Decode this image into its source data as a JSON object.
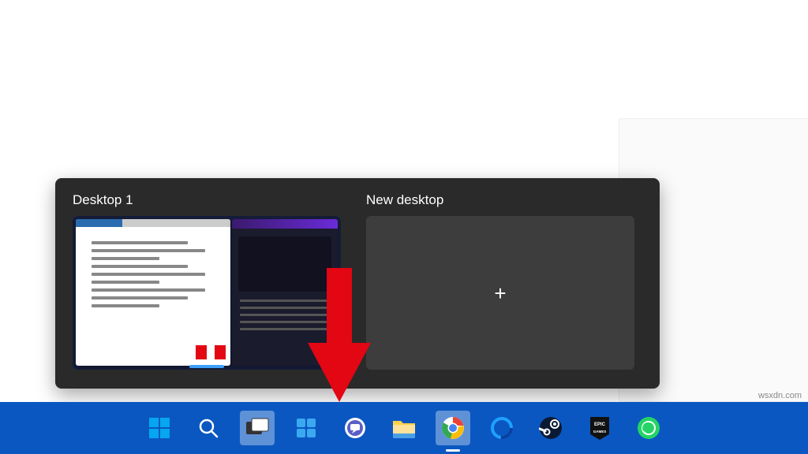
{
  "task_view": {
    "desktop_label": "Desktop 1",
    "new_desktop_label": "New desktop",
    "plus_symbol": "+"
  },
  "taskbar": {
    "items": [
      {
        "name": "start",
        "highlight": false
      },
      {
        "name": "search",
        "highlight": false
      },
      {
        "name": "task-view",
        "highlight": true
      },
      {
        "name": "widgets",
        "highlight": false
      },
      {
        "name": "chat",
        "highlight": false
      },
      {
        "name": "file-explorer",
        "highlight": false
      },
      {
        "name": "chrome",
        "highlight": true
      },
      {
        "name": "cortana",
        "highlight": false
      },
      {
        "name": "steam",
        "highlight": false
      },
      {
        "name": "epic-games",
        "highlight": false
      },
      {
        "name": "whatsapp",
        "highlight": false
      }
    ]
  },
  "watermark": "wsxdn.com",
  "colors": {
    "taskbar": "#0a57c2",
    "popup": "#2a2a2a",
    "arrow": "#e30613",
    "accent": "#3da0ff"
  }
}
